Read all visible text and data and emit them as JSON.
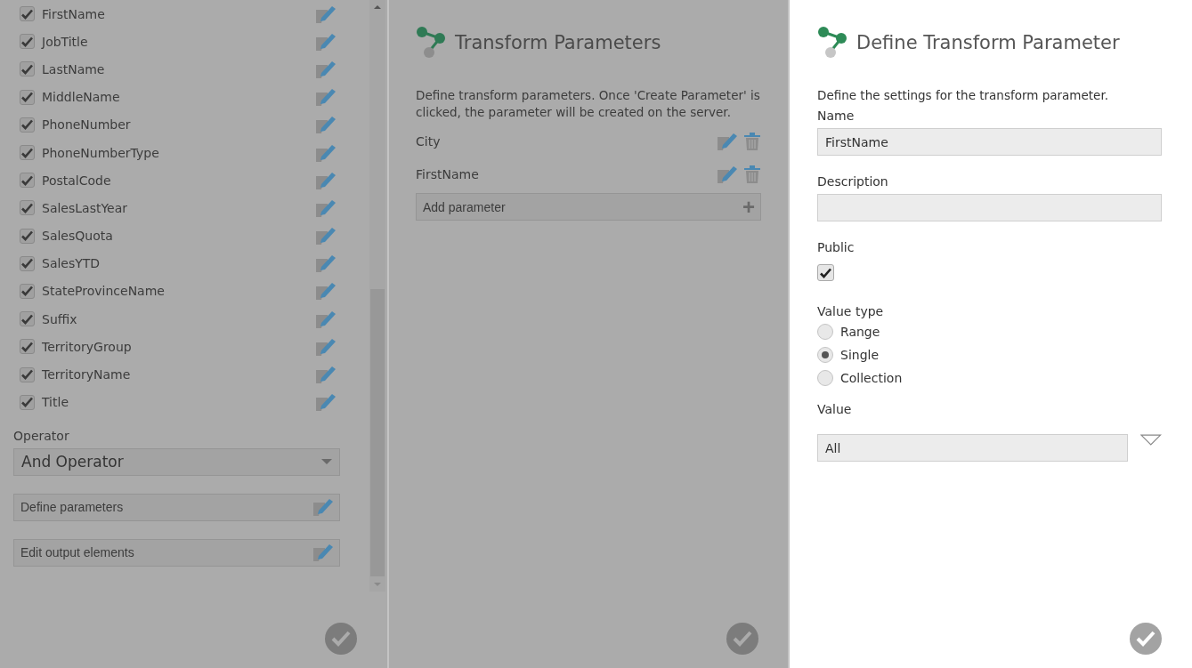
{
  "field_panel": {
    "dimmed": true,
    "items": [
      {
        "label": "FirstName",
        "checked": true
      },
      {
        "label": "JobTitle",
        "checked": true
      },
      {
        "label": "LastName",
        "checked": true
      },
      {
        "label": "MiddleName",
        "checked": true
      },
      {
        "label": "PhoneNumber",
        "checked": true
      },
      {
        "label": "PhoneNumberType",
        "checked": true
      },
      {
        "label": "PostalCode",
        "checked": true
      },
      {
        "label": "SalesLastYear",
        "checked": true
      },
      {
        "label": "SalesQuota",
        "checked": true
      },
      {
        "label": "SalesYTD",
        "checked": true
      },
      {
        "label": "StateProvinceName",
        "checked": true
      },
      {
        "label": "Suffix",
        "checked": true
      },
      {
        "label": "TerritoryGroup",
        "checked": true
      },
      {
        "label": "TerritoryName",
        "checked": true
      },
      {
        "label": "Title",
        "checked": true
      }
    ],
    "operator": {
      "label": "Operator",
      "value": "And Operator"
    },
    "actions": [
      {
        "label": "Define parameters"
      },
      {
        "label": "Edit output elements"
      }
    ]
  },
  "transform_parameters": {
    "dimmed": true,
    "title": "Transform Parameters",
    "description": "Define transform parameters. Once 'Create Parameter' is clicked, the parameter will be created on the server.",
    "parameters": [
      {
        "name": "City"
      },
      {
        "name": "FirstName"
      }
    ],
    "add_label": "Add parameter",
    "add_symbol": "+"
  },
  "define_parameter": {
    "dimmed": false,
    "title": "Define Transform Parameter",
    "description": "Define the settings for the transform parameter.",
    "name": {
      "label": "Name",
      "value": "FirstName"
    },
    "description_field": {
      "label": "Description"
    },
    "public": {
      "label": "Public",
      "checked": true
    },
    "value_type": {
      "label": "Value type",
      "options": [
        {
          "label": "Range",
          "selected": false
        },
        {
          "label": "Single",
          "selected": true
        },
        {
          "label": "Collection",
          "selected": false
        }
      ]
    },
    "value": {
      "label": "Value",
      "value": "All"
    }
  }
}
